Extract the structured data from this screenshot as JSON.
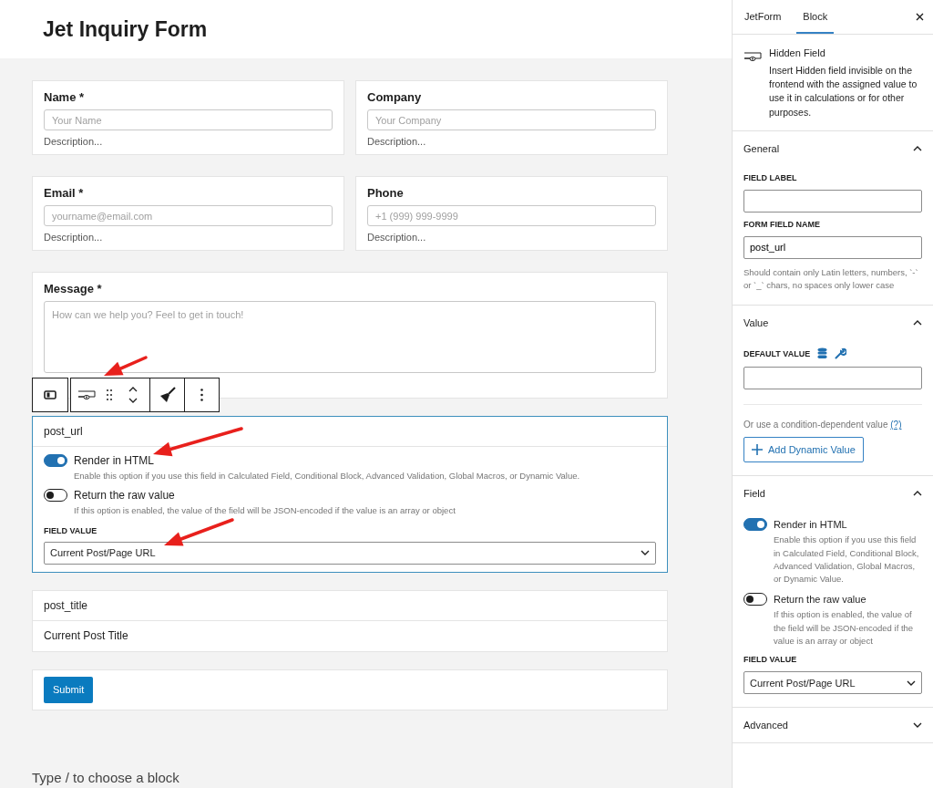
{
  "title": "Jet Inquiry Form",
  "field_rows": [
    [
      {
        "label": "Name *",
        "placeholder": "Your Name",
        "description": "Description..."
      },
      {
        "label": "Company",
        "placeholder": "Your Company",
        "description": "Description..."
      }
    ],
    [
      {
        "label": "Email *",
        "placeholder": "yourname@email.com",
        "description": "Description..."
      },
      {
        "label": "Phone",
        "placeholder": "+1 (999) 999-9999",
        "description": "Description..."
      }
    ]
  ],
  "message": {
    "label": "Message *",
    "placeholder": "How can we help you? Feel to get in touch!"
  },
  "hidden_field": {
    "name": "post_url",
    "toggles": [
      {
        "label": "Render in HTML",
        "description": "Enable this option if you use this field in Calculated Field, Conditional Block, Advanced Validation, Global Macros, or Dynamic Value.",
        "on": true
      },
      {
        "label": "Return the raw value",
        "description": "If this option is enabled, the value of the field will be JSON-encoded if the value is an array or object",
        "on": false
      }
    ],
    "value_label": "FIELD VALUE",
    "value": "Current Post/Page URL"
  },
  "post_title": {
    "name": "post_title",
    "value": "Current Post Title"
  },
  "submit": "Submit",
  "appender": "Type / to choose a block",
  "sidebar": {
    "tabs": [
      {
        "label": "JetForm",
        "selected": false
      },
      {
        "label": "Block",
        "selected": true
      }
    ],
    "block": {
      "title": "Hidden Field",
      "description": "Insert Hidden field invisible on the frontend with the assigned value to use it in calculations or for other purposes."
    },
    "panels": [
      {
        "kind": "general",
        "title": "General",
        "expanded": true,
        "field_label": "FIELD LABEL",
        "name_label": "FORM FIELD NAME",
        "name_value": "post_url",
        "help": "Should contain only Latin letters, numbers, `-` or `_` chars, no spaces only lower case"
      },
      {
        "kind": "value",
        "title": "Value",
        "expanded": true,
        "default_label": "DEFAULT VALUE",
        "condition_text": "Or use a condition-dependent value",
        "help_link": "(?)",
        "button": "Add Dynamic Value"
      },
      {
        "kind": "field",
        "title": "Field",
        "expanded": true,
        "toggles": [
          {
            "label": "Render in HTML",
            "description": "Enable this option if you use this field in Calculated Field, Conditional Block, Advanced Validation, Global Macros, or Dynamic Value.",
            "on": true
          },
          {
            "label": "Return the raw value",
            "description": "If this option is enabled, the value of the field will be JSON-encoded if the value is an array or object",
            "on": false
          }
        ],
        "value_label": "FIELD VALUE",
        "value": "Current Post/Page URL"
      },
      {
        "title": "Advanced",
        "expanded": false
      }
    ]
  }
}
